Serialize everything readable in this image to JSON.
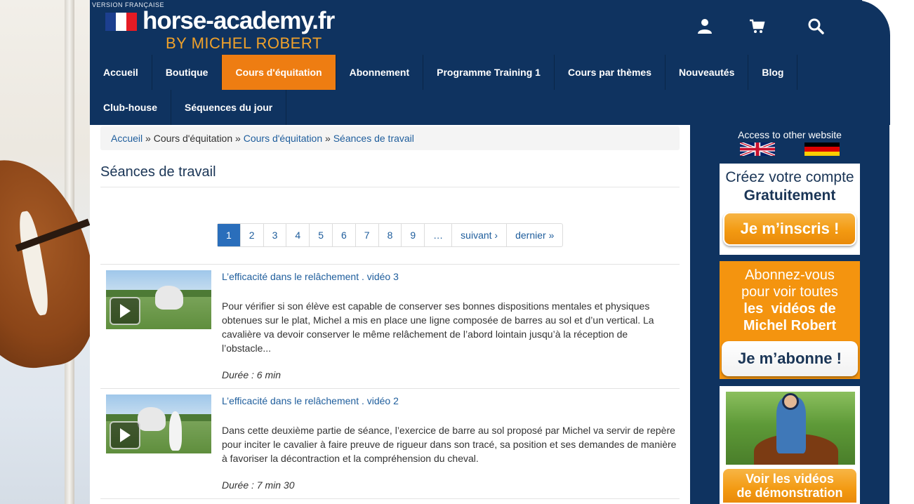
{
  "header": {
    "version_label": "VERSION FRANÇAISE",
    "logo_title": "horse-academy.fr",
    "logo_subtitle": "BY MICHEL ROBERT",
    "icons": [
      "user-icon",
      "cart-icon",
      "search-icon"
    ]
  },
  "nav": {
    "row1": [
      "Accueil",
      "Boutique",
      "Cours d'équitation",
      "Abonnement",
      "Programme Training 1",
      "Cours par thèmes",
      "Nouveautés",
      "Blog"
    ],
    "row2": [
      "Club-house",
      "Séquences du jour"
    ],
    "active": "Cours d'équitation"
  },
  "breadcrumb": {
    "home": "Accueil",
    "sep": "»",
    "level1": "Cours d'équitation",
    "level2": "Cours d'équitation",
    "current": "Séances de travail"
  },
  "page": {
    "title": "Séances de travail"
  },
  "pager": {
    "pages": [
      "1",
      "2",
      "3",
      "4",
      "5",
      "6",
      "7",
      "8",
      "9",
      "…"
    ],
    "current": "1",
    "next": "suivant ›",
    "last": "dernier »"
  },
  "items": [
    {
      "title": "L’efficacité dans le relâchement . vidéo 3",
      "description": "Pour vérifier si son élève est capable de conserver ses bonnes dispositions mentales et physiques obtenues sur le plat, Michel a mis en place une ligne composée de barres au sol et d’un vertical. La cavalière va devoir conserver le même relâchement de l’abord lointain jusqu’à la réception de l’obstacle...",
      "duration": "Durée : 6 min"
    },
    {
      "title": "L’efficacité dans le relâchement . vidéo 2",
      "description": "Dans cette deuxième partie de séance, l’exercice de barre au sol proposé par Michel va servir de repère pour inciter le cavalier à faire preuve de rigueur dans son tracé, sa position et ses demandes de manière à favoriser la décontraction et la compréhension du cheval.",
      "duration": "Durée : 7 min 30"
    }
  ],
  "sidebar": {
    "access_label": "Access to other website",
    "promo_account": {
      "line1": "Créez votre compte",
      "line2": "Gratuitement",
      "button": "Je m’inscris !"
    },
    "promo_subscribe": {
      "line1": "Abonnez-vous",
      "line2": "pour voir toutes",
      "line3": "les  vidéos de",
      "line4": "Michel Robert",
      "button": "Je m’abonne !"
    },
    "promo_demo": {
      "line1": "Voir les vidéos",
      "line2": "de démonstration"
    }
  },
  "colors": {
    "header_bg": "#0f3360",
    "accent_orange": "#ee7d12",
    "link_blue": "#1e5d9c"
  }
}
